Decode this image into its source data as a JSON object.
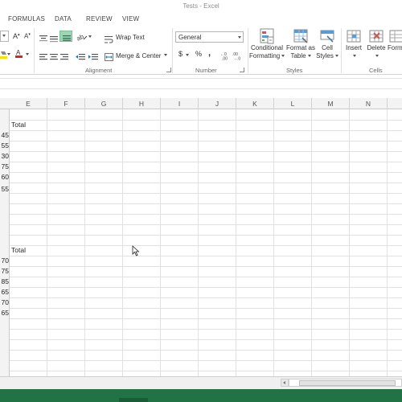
{
  "window": {
    "title": "Tests - Excel"
  },
  "tabs": [
    {
      "label": "FORMULAS"
    },
    {
      "label": "DATA"
    },
    {
      "label": "REVIEW"
    },
    {
      "label": "VIEW"
    }
  ],
  "ribbon": {
    "alignment": {
      "wrap_text_label": "Wrap Text",
      "merge_center_label": "Merge & Center",
      "group_label": "Alignment"
    },
    "number": {
      "format_value": "General",
      "currency_symbol": "$",
      "percent_symbol": "%",
      "comma_symbol": ",",
      "group_label": "Number"
    },
    "styles": {
      "conditional_formatting_label_1": "Conditional",
      "conditional_formatting_label_2": "Formatting",
      "format_as_table_label_1": "Format as",
      "format_as_table_label_2": "Table",
      "cell_styles_label_1": "Cell",
      "cell_styles_label_2": "Styles",
      "group_label": "Styles"
    },
    "cells": {
      "insert_label": "Insert",
      "delete_label": "Delete",
      "format_label": "Form",
      "group_label": "Cells"
    }
  },
  "grid": {
    "columns": [
      "E",
      "F",
      "G",
      "H",
      "I",
      "J",
      "K",
      "L",
      "M",
      "N"
    ],
    "cells": {
      "total_header_1": "Total",
      "total_header_2": "Total",
      "col_d_values_1": [
        "45",
        "55",
        "30",
        "75",
        "60",
        "",
        "55"
      ],
      "col_d_values_2": [
        "70",
        "75",
        "85",
        "65",
        "70",
        "65"
      ]
    }
  },
  "colors": {
    "status_bar": "#217346",
    "selected_button": "#9fd5b7",
    "grid_line": "#e1e1e1",
    "header_bg": "#f3f3f3"
  }
}
